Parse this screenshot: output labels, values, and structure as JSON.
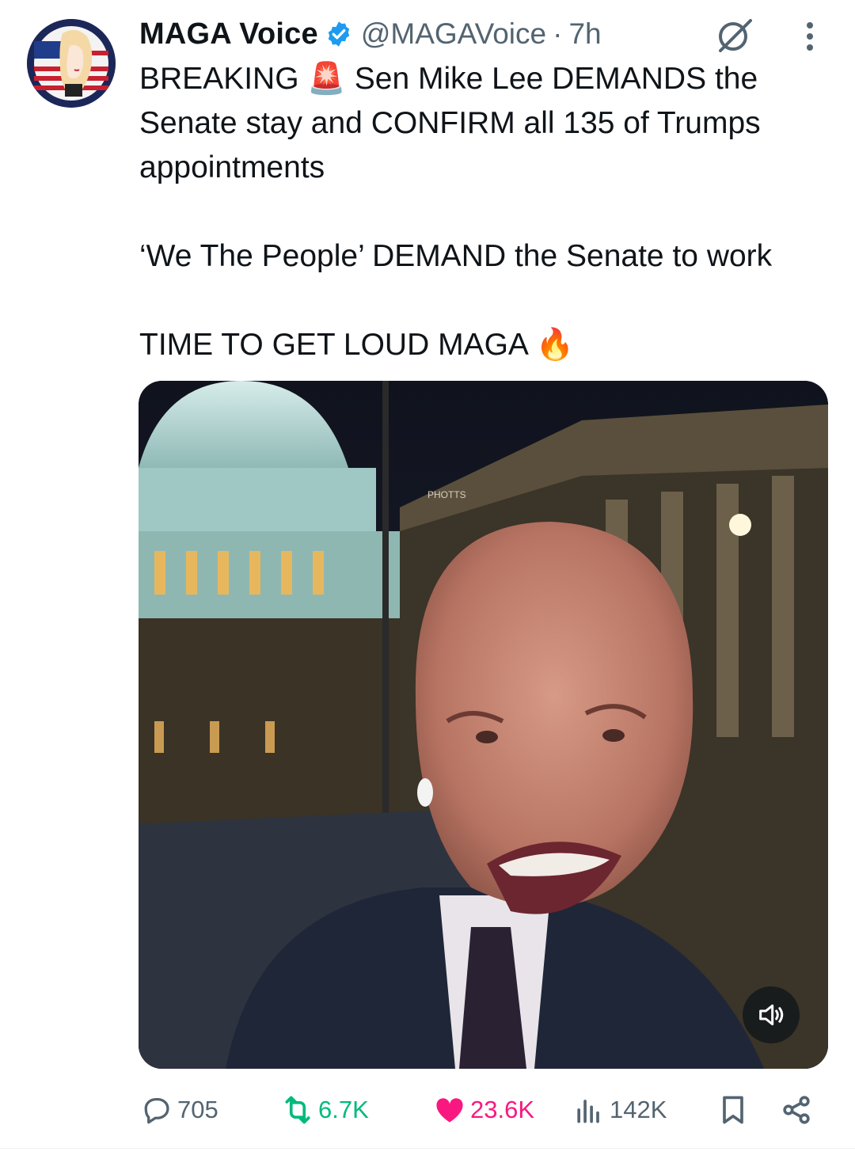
{
  "author": {
    "name": "MAGA Voice",
    "handle": "@MAGAVoice",
    "separator": "·",
    "time": "7h",
    "verified": true,
    "verified_color": "#1d9bf0"
  },
  "tweet": {
    "text": "BREAKING 🚨 Sen Mike Lee DEMANDS the Senate stay and CONFIRM all 135 of Trumps appointments\n\n‘We The People’ DEMAND the Senate to work\n\nTIME TO GET LOUD MAGA 🔥"
  },
  "media": {
    "icon": "volume-icon",
    "building_sign": "PHOTTS"
  },
  "stats": {
    "replies": "705",
    "reposts": "6.7K",
    "likes": "23.6K",
    "views": "142K"
  },
  "icons": {
    "header": [
      "verified-badge-icon",
      "grok-icon",
      "more-options-icon"
    ],
    "actions": [
      "reply-icon",
      "repost-icon",
      "like-icon",
      "views-icon",
      "bookmark-icon",
      "share-icon"
    ]
  },
  "colors": {
    "text": "#0f1419",
    "secondary": "#536471",
    "repost": "#00ba7c",
    "like": "#f91880"
  }
}
